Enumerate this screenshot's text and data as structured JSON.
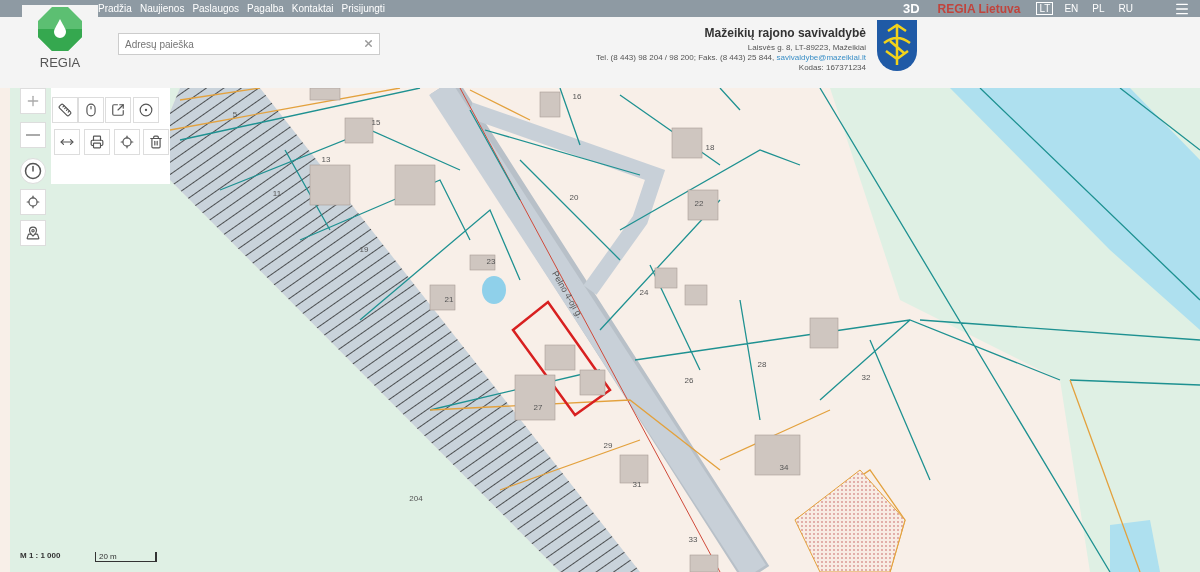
{
  "nav": {
    "links": [
      "Pradžia",
      "Naujienos",
      "Paslaugos",
      "Pagalba",
      "Kontaktai",
      "Prisijungti"
    ],
    "view_3d": "3D",
    "brand": "REGIA Lietuva",
    "languages": [
      {
        "label": "LT",
        "selected": true
      },
      {
        "label": "EN",
        "selected": false
      },
      {
        "label": "PL",
        "selected": false
      },
      {
        "label": "RU",
        "selected": false
      }
    ]
  },
  "logo": {
    "name": "REGIA"
  },
  "search": {
    "placeholder": "Adresų paieška"
  },
  "municipality": {
    "name": "Mažeikių rajono savivaldybė",
    "address": "Laisvės g. 8, LT-89223, Mažeikiai",
    "phone": "Tel. (8 443) 98 204 / 98 200; Faks. (8 443) 25 844,",
    "email": "savivaldybe@mazeikiai.lt",
    "code": "Kodas: 167371234"
  },
  "map": {
    "labels": [
      "5",
      "16",
      "15",
      "13",
      "18",
      "11",
      "20",
      "22",
      "19",
      "23",
      "21",
      "24",
      "Pelno 4-oji g.",
      "26",
      "28",
      "32",
      "27",
      "29",
      "34",
      "31",
      "33",
      "204"
    ],
    "scale": "M 1 : 1 000",
    "scale_bar": "20 m"
  }
}
